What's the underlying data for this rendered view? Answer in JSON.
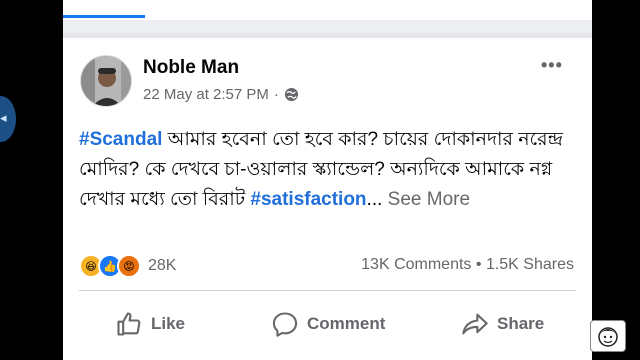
{
  "post": {
    "author": "Noble Man",
    "timestamp": "22 May at 2:57 PM",
    "separator": "·",
    "privacy_icon": "globe-icon",
    "more_icon": "more-dots-icon",
    "text": {
      "tag1": "#Scandal",
      "body": " আমার হবেনা তো হবে কার? চায়ের দোকানদার নরেন্দ্র মোদির? কে দেখবে চা-ওয়ালার স্ক্যান্ডেল? অন্যদিকে আমাকে নগ্ন দেখার মধ্যে তো বিরাট ",
      "tag2": "#satisfaction",
      "ellipsis": "...",
      "see_more": " See More"
    }
  },
  "engagement": {
    "reactions_count": "28K",
    "comments": "13K Comments",
    "dot": "•",
    "shares": "1.5K Shares"
  },
  "actions": {
    "like": "Like",
    "comment": "Comment",
    "share": "Share"
  },
  "colors": {
    "accent": "#1877f2",
    "hashtag": "#216fdb",
    "muted": "#65676b"
  }
}
